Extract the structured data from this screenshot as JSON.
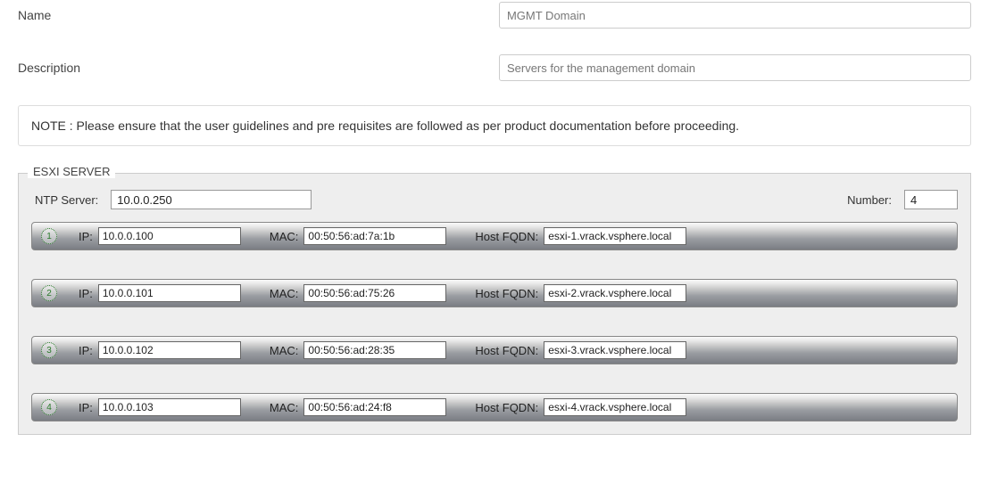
{
  "fields": {
    "nameLabel": "Name",
    "nameValue": "MGMT Domain",
    "descLabel": "Description",
    "descValue": "Servers for the management domain"
  },
  "note": "NOTE : Please ensure that the user guidelines and pre requisites are followed as per product documentation before proceeding.",
  "esxi": {
    "legend": "ESXI SERVER",
    "ntpLabel": "NTP Server:",
    "ntpValue": "10.0.0.250",
    "numberLabel": "Number:",
    "numberValue": "4",
    "ipLabel": "IP:",
    "macLabel": "MAC:",
    "fqdnLabel": "Host FQDN:",
    "rows": [
      {
        "n": "1",
        "ip": "10.0.0.100",
        "mac": "00:50:56:ad:7a:1b",
        "fqdn": "esxi-1.vrack.vsphere.local"
      },
      {
        "n": "2",
        "ip": "10.0.0.101",
        "mac": "00:50:56:ad:75:26",
        "fqdn": "esxi-2.vrack.vsphere.local"
      },
      {
        "n": "3",
        "ip": "10.0.0.102",
        "mac": "00:50:56:ad:28:35",
        "fqdn": "esxi-3.vrack.vsphere.local"
      },
      {
        "n": "4",
        "ip": "10.0.0.103",
        "mac": "00:50:56:ad:24:f8",
        "fqdn": "esxi-4.vrack.vsphere.local"
      }
    ]
  }
}
